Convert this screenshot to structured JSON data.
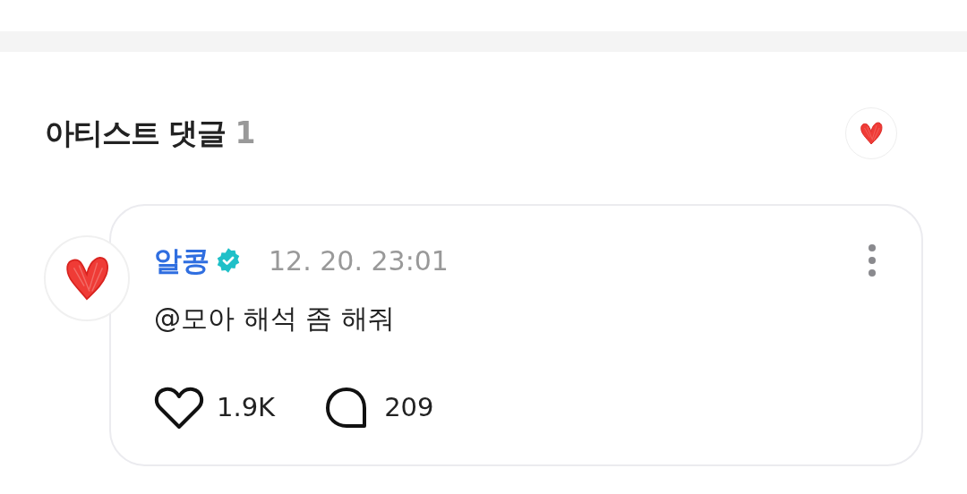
{
  "section": {
    "title": "아티스트 댓글",
    "count": "1"
  },
  "comment": {
    "author": "알콩",
    "verified": true,
    "time": "12. 20. 23:01",
    "text": "@모아 해석 좀 해줘",
    "likes": "1.9K",
    "replies": "209"
  }
}
